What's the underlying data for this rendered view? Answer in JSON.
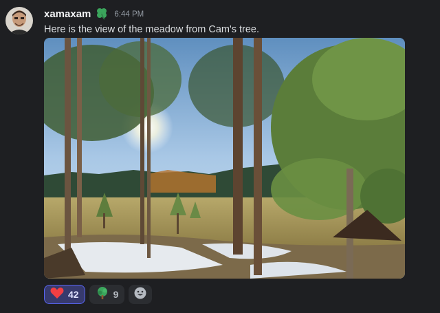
{
  "message": {
    "author": "xamaxam",
    "timestamp": "6:44 PM",
    "text": "Here is the view of the meadow from Cam's tree."
  },
  "icons": {
    "author_badge": "four-leaf-clover-icon",
    "add_reaction": "smiley-face-icon"
  },
  "reactions": [
    {
      "emoji": "heart-icon",
      "count": "42",
      "active": true
    },
    {
      "emoji": "tree-icon",
      "count": "9",
      "active": false
    }
  ],
  "colors": {
    "background": "#1e1f22",
    "accent": "#5865f2",
    "heart": "#f23f43",
    "clover": "#3ba55c"
  }
}
